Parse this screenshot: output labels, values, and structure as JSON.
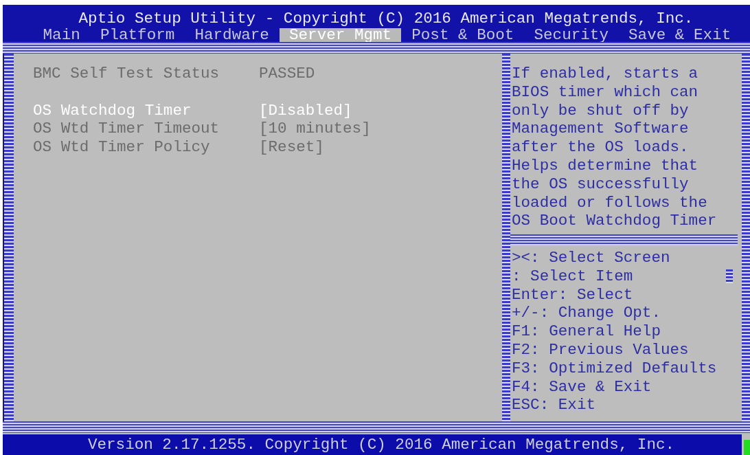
{
  "title": "Aptio Setup Utility - Copyright (C) 2016 American Megatrends, Inc.",
  "tabs": [
    {
      "label": "Main",
      "selected": false
    },
    {
      "label": "Platform",
      "selected": false
    },
    {
      "label": "Hardware",
      "selected": false
    },
    {
      "label": "Server Mgmt",
      "selected": true
    },
    {
      "label": "Post & Boot",
      "selected": false
    },
    {
      "label": "Security",
      "selected": false
    },
    {
      "label": "Save & Exit",
      "selected": false
    }
  ],
  "status_items": [
    {
      "label": "BMC Self Test Status",
      "value": "PASSED"
    }
  ],
  "options": [
    {
      "label": "OS Watchdog Timer",
      "value": "[Disabled]",
      "selected": true
    },
    {
      "label": "OS Wtd Timer Timeout",
      "value": "[10 minutes]",
      "selected": false
    },
    {
      "label": "OS Wtd Timer Policy",
      "value": "[Reset]",
      "selected": false
    }
  ],
  "help_text": "If enabled, starts a BIOS timer which can only be shut off by Management Software after the OS loads. Helps determine that the OS successfully loaded or follows the OS Boot Watchdog Timer",
  "key_hints": [
    "><: Select Screen",
    ": Select Item",
    "Enter: Select",
    "+/-: Change Opt.",
    "F1: General Help",
    "F2: Previous Values",
    "F3: Optimized Defaults",
    "F4: Save & Exit",
    "ESC: Exit"
  ],
  "status_bar": "Version 2.17.1255. Copyright (C) 2016 American Megatrends, Inc."
}
